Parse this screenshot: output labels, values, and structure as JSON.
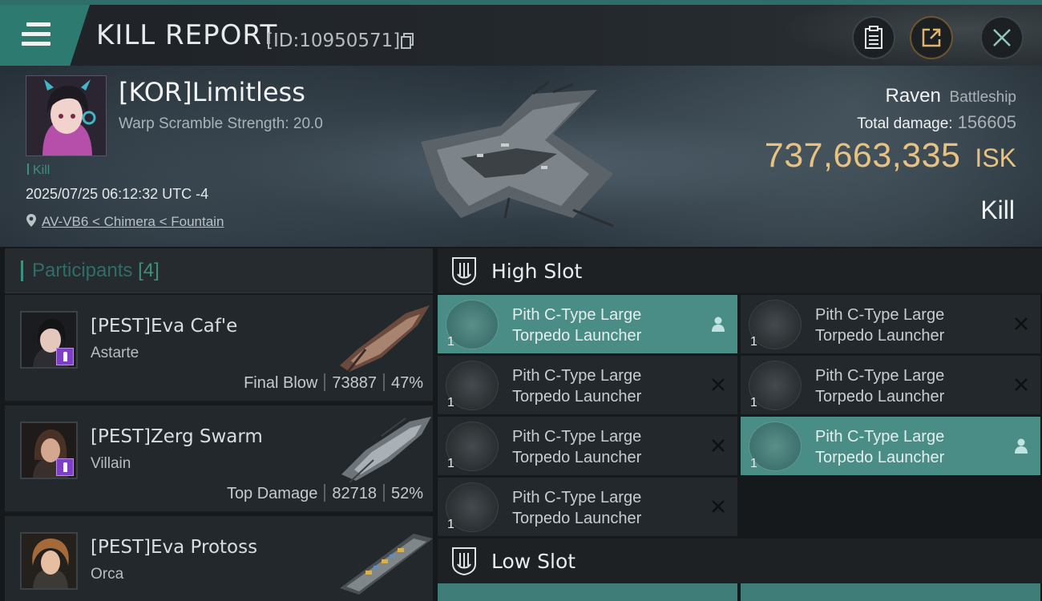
{
  "header": {
    "title": "KILL REPORT",
    "report_id": "[ID:10950571]"
  },
  "victim": {
    "name": "[KOR]Limitless",
    "warp_scramble": "Warp Scramble Strength: 20.0",
    "kill_tag": "Kill",
    "timestamp": "2025/07/25 06:12:32 UTC -4",
    "location": "AV-VB6 < Chimera < Fountain",
    "ship": "Raven",
    "ship_class": "Battleship",
    "total_damage_label": "Total damage:",
    "total_damage": "156605",
    "isk_value": "737,663,335",
    "isk_unit": "ISK",
    "result": "Kill"
  },
  "participants": {
    "label": "Participants",
    "count": "[4]",
    "rows": [
      {
        "name": "[PEST]Eva Caf'e",
        "ship": "Astarte",
        "role": "Final Blow",
        "damage": "73887",
        "percent": "47%"
      },
      {
        "name": "[PEST]Zerg Swarm",
        "ship": "Villain",
        "role": "Top Damage",
        "damage": "82718",
        "percent": "52%"
      },
      {
        "name": "[PEST]Eva Protoss",
        "ship": "Orca"
      }
    ]
  },
  "high_slot": {
    "label": "High Slot",
    "modules": [
      {
        "line1": "Pith C-Type Large",
        "line2": "Torpedo Launcher",
        "qty": "1",
        "status": "dropped"
      },
      {
        "line1": "Pith C-Type Large",
        "line2": "Torpedo Launcher",
        "qty": "1",
        "status": "destroyed"
      },
      {
        "line1": "Pith C-Type Large",
        "line2": "Torpedo Launcher",
        "qty": "1",
        "status": "destroyed"
      },
      {
        "line1": "Pith C-Type Large",
        "line2": "Torpedo Launcher",
        "qty": "1",
        "status": "destroyed"
      },
      {
        "line1": "Pith C-Type Large",
        "line2": "Torpedo Launcher",
        "qty": "1",
        "status": "destroyed"
      },
      {
        "line1": "Pith C-Type Large",
        "line2": "Torpedo Launcher",
        "qty": "1",
        "status": "dropped"
      },
      {
        "line1": "Pith C-Type Large",
        "line2": "Torpedo Launcher",
        "qty": "1",
        "status": "destroyed"
      }
    ]
  },
  "low_slot": {
    "label": "Low Slot"
  },
  "colors": {
    "accent": "#2f6e68",
    "selected_row": "#4a8d86",
    "isk": "#e8c281",
    "badge": "#7d3fc5"
  }
}
